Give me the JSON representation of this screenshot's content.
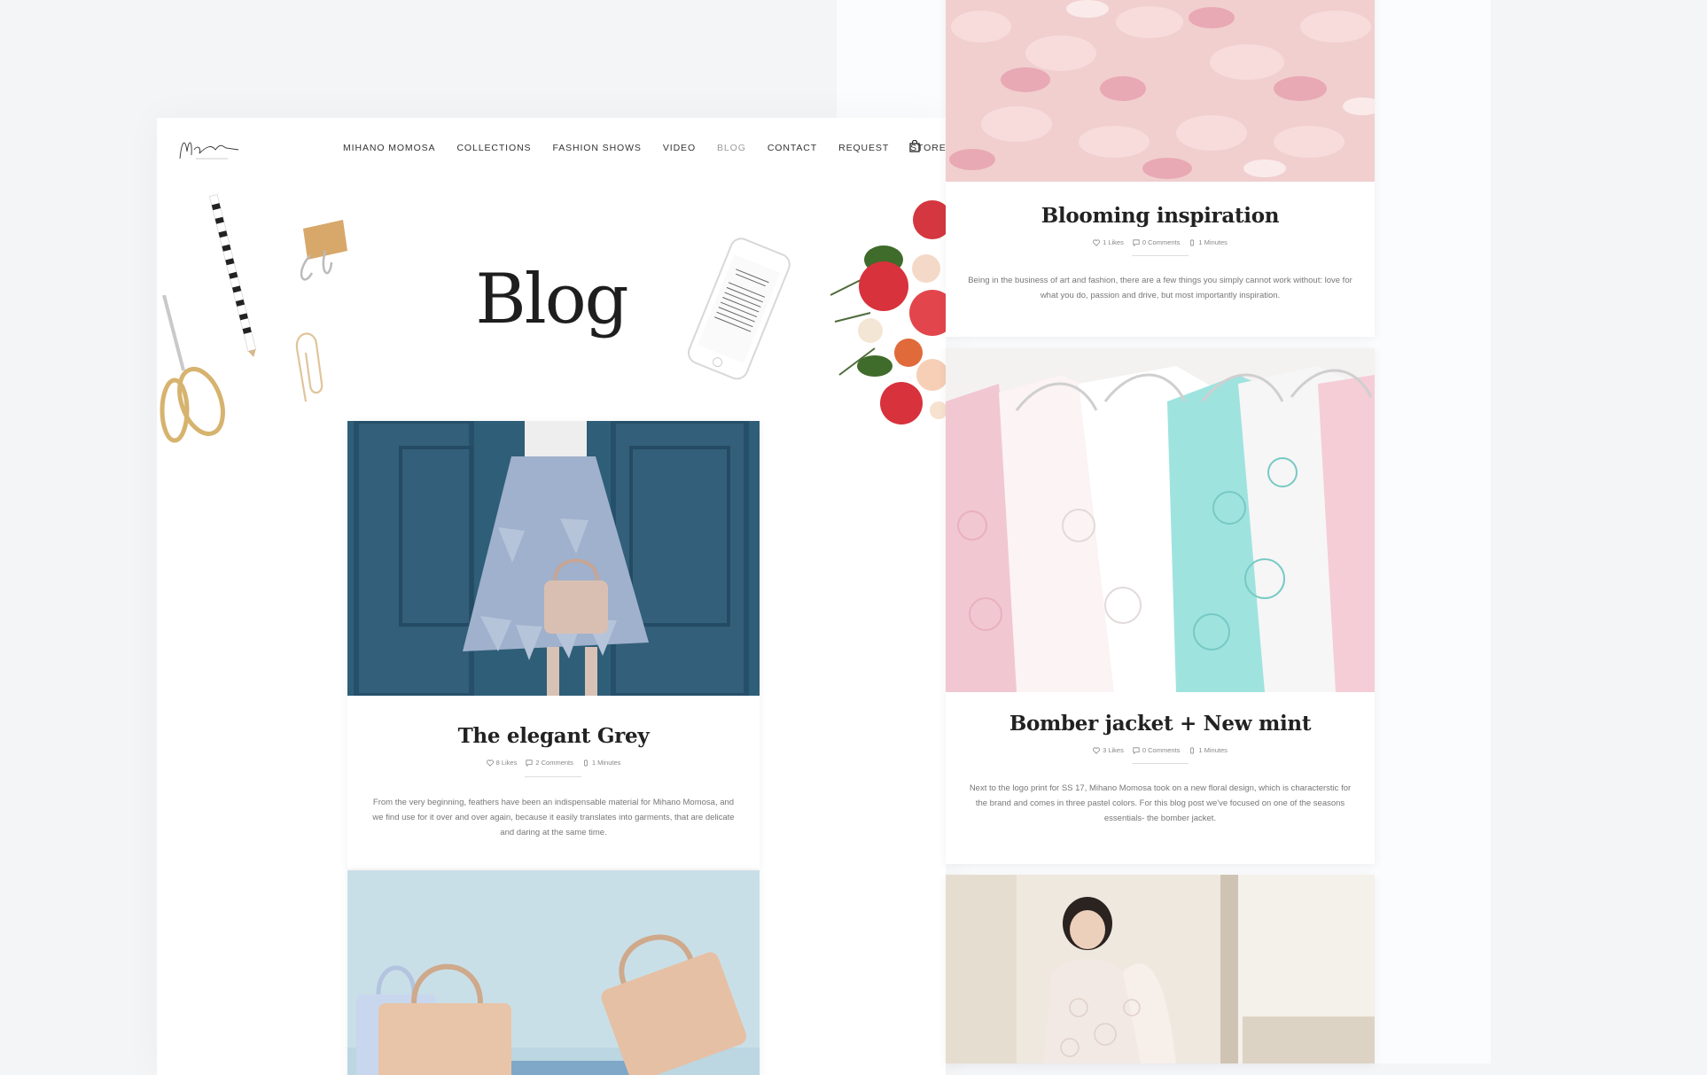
{
  "nav": {
    "items": [
      "MIHANO MOMOSA",
      "COLLECTIONS",
      "FASHION SHOWS",
      "VIDEO",
      "BLOG",
      "CONTACT",
      "REQUEST",
      "STORE"
    ],
    "active": "BLOG"
  },
  "hero": {
    "title": "Blog"
  },
  "posts": [
    {
      "title": "The elegant Grey",
      "likes": "8 Likes",
      "comments": "2 Comments",
      "minutes": "1 Minutes",
      "excerpt": "From the very beginning, feathers have been an indispensable material for Mihano Momosa, and we find use for it over and over again, because it easily translates into garments, that are delicate and daring at the same time."
    },
    {
      "title": "Blooming inspiration",
      "likes": "1 Likes",
      "comments": "0 Comments",
      "minutes": "1 Minutes",
      "excerpt": "Being in the business of art and fashion, there are a few things you simply cannot work without: love for what you do, passion and drive, but most importantly inspiration."
    },
    {
      "title": "Bomber jacket + New mint",
      "likes": "3 Likes",
      "comments": "0 Comments",
      "minutes": "1 Minutes",
      "excerpt": "Next to the logo print for SS 17, Mihano Momosa took on a new floral design, which is characterstic for the brand and comes in three pastel colors. For this blog post we've focused on one of the seasons essentials- the bomber jacket."
    }
  ],
  "colors": {
    "accent_text": "#1e1e1e",
    "muted": "#888888",
    "active_nav": "#9a9a9a",
    "page_bg": "#f3f5f7"
  }
}
